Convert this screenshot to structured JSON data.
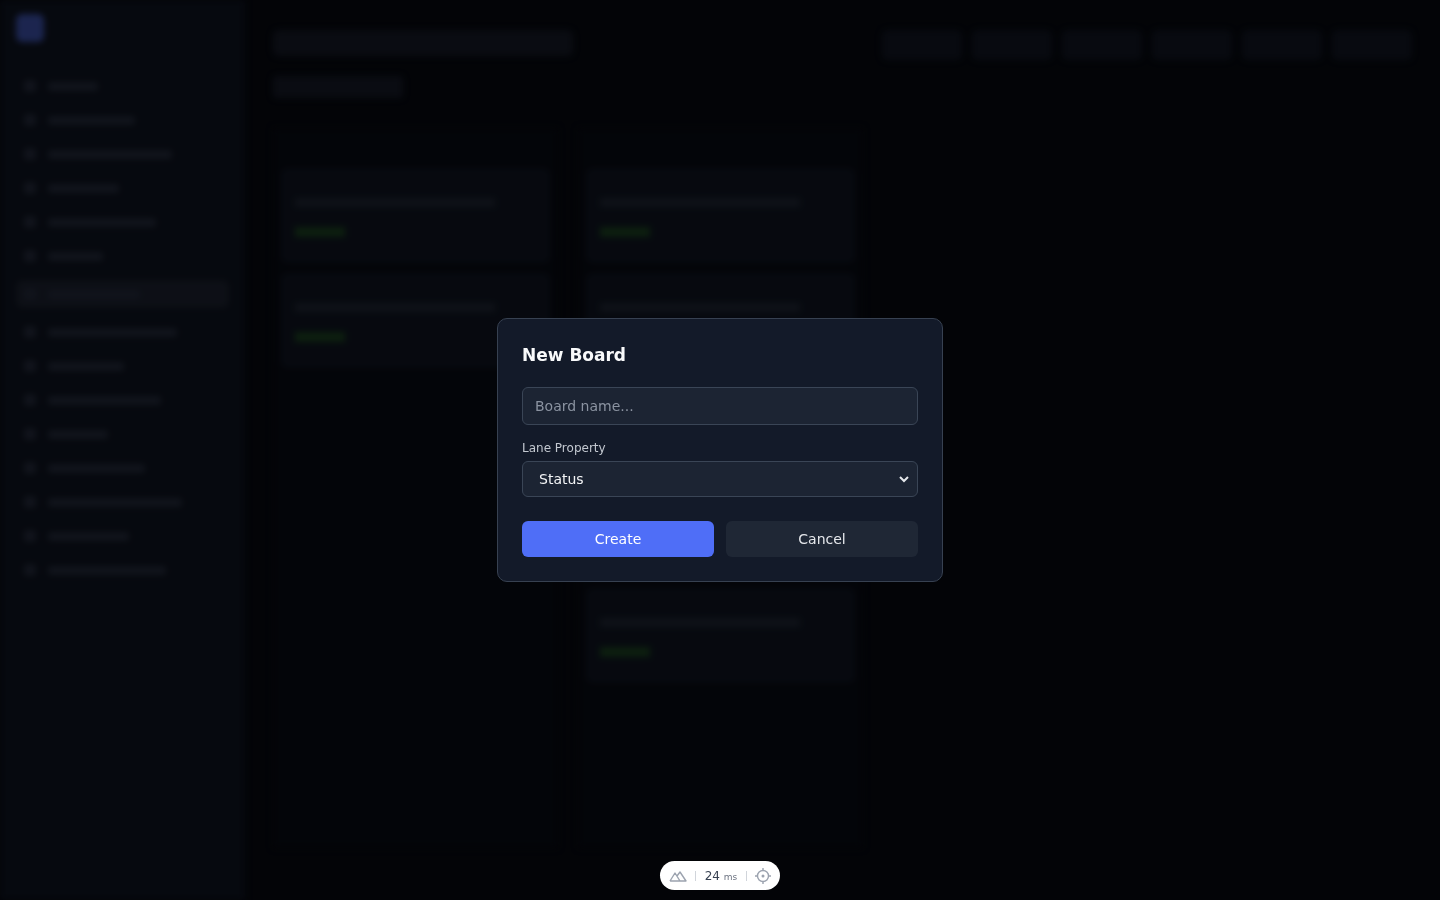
{
  "dialog": {
    "title": "New Board",
    "name_field": {
      "placeholder": "Board name..."
    },
    "lane_property": {
      "label": "Lane Property",
      "value": "Status"
    },
    "buttons": [
      {
        "label": "Create",
        "kind": "primary"
      },
      {
        "label": "Cancel",
        "kind": "secondary"
      }
    ]
  },
  "dev_toolbar": {
    "time": "24",
    "unit": "ms"
  }
}
